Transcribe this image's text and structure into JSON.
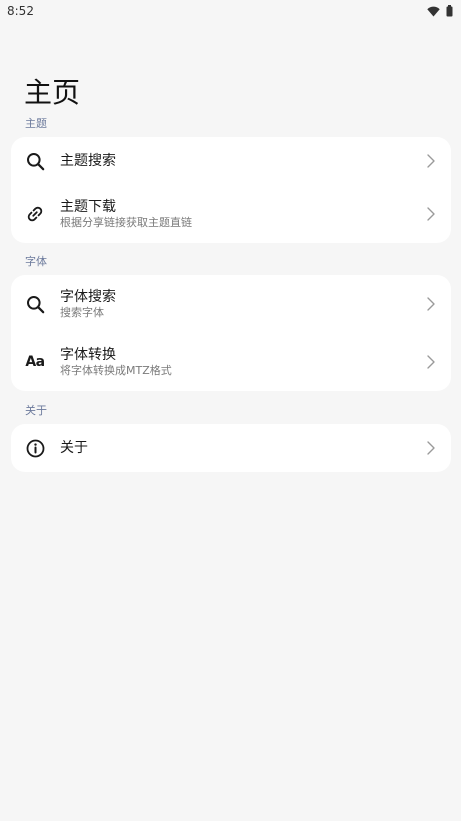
{
  "status_bar": {
    "time": "8:52",
    "icons": [
      "wifi-icon",
      "battery-icon"
    ]
  },
  "page": {
    "title": "主页"
  },
  "sections": [
    {
      "label": "主题",
      "items": [
        {
          "title": "主题搜索",
          "subtitle": "",
          "icon": "search-icon"
        },
        {
          "title": "主题下载",
          "subtitle": "根据分享链接获取主题直链",
          "icon": "link-icon"
        }
      ]
    },
    {
      "label": "字体",
      "items": [
        {
          "title": "字体搜索",
          "subtitle": "搜索字体",
          "icon": "search-icon"
        },
        {
          "title": "字体转换",
          "subtitle": "将字体转换成MTZ格式",
          "icon": "font-aa-icon",
          "icon_text": "Aa"
        }
      ]
    },
    {
      "label": "关于",
      "items": [
        {
          "title": "关于",
          "subtitle": "",
          "icon": "info-icon"
        }
      ]
    }
  ],
  "colors": {
    "background": "#f6f6f6",
    "card": "#ffffff",
    "section_label": "#6c7a9c",
    "chevron": "#9a9a9a"
  }
}
